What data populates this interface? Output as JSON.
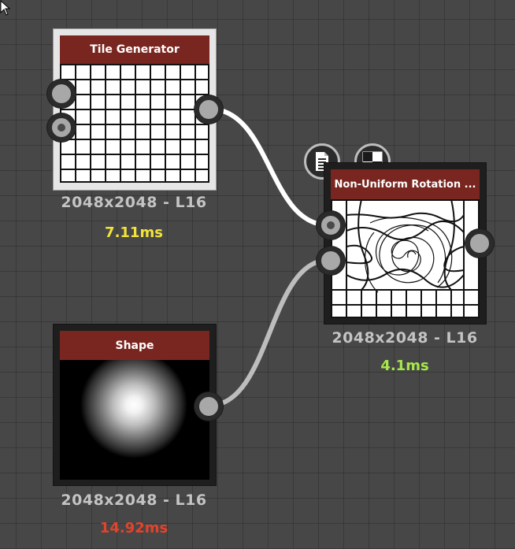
{
  "nodes": {
    "tile_generator": {
      "title": "Tile Generator",
      "resolution": "2048x2048 - L16",
      "time": "7.11ms",
      "time_color": "#f2e33a"
    },
    "non_uniform_rotation": {
      "title": "Non-Uniform Rotation ...",
      "resolution": "2048x2048 - L16",
      "time": "4.1ms",
      "time_color": "#a6e84a"
    },
    "shape": {
      "title": "Shape",
      "resolution": "2048x2048 - L16",
      "time": "14.92ms",
      "time_color": "#e5422b"
    }
  },
  "node_toolbar": {
    "icons": [
      "document-icon",
      "checker-preview-icon"
    ]
  },
  "colors": {
    "header": "#7a2620",
    "grid_bg": "#474747",
    "wire": "#ffffff"
  }
}
